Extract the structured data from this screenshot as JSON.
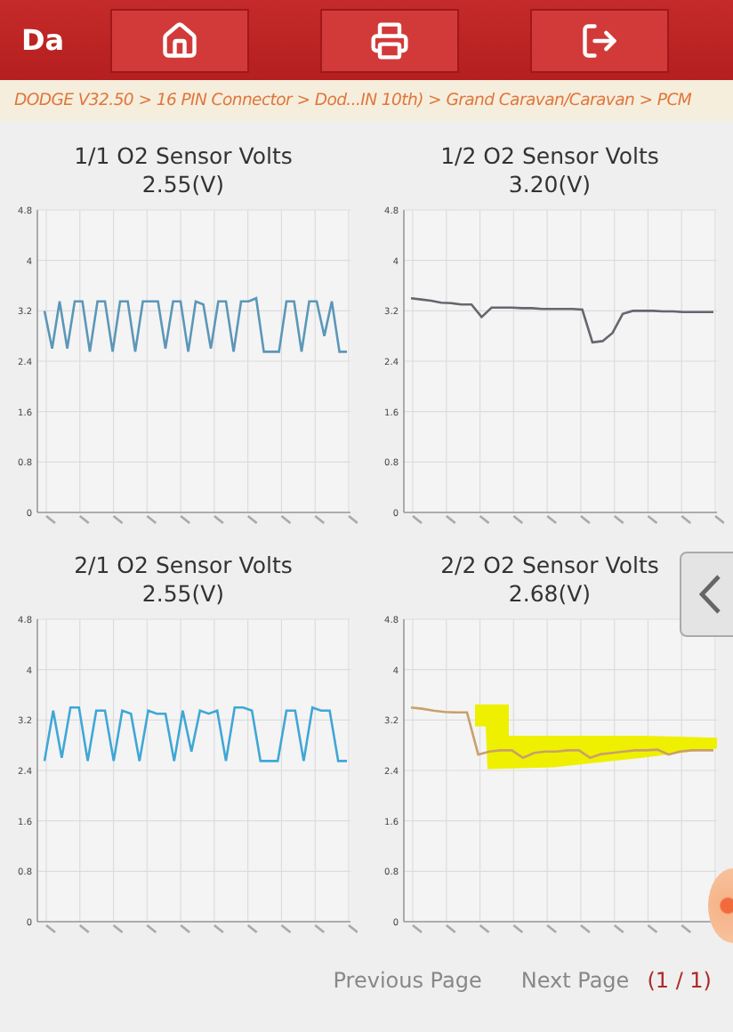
{
  "header": {
    "title": "Da",
    "buttons": [
      {
        "kind": "home"
      },
      {
        "kind": "print"
      },
      {
        "kind": "exit"
      }
    ]
  },
  "breadcrumb": "DODGE V32.50 > 16 PIN Connector > Dod...IN 10th) > Grand Caravan/Caravan > PCM",
  "charts": [
    {
      "title": "1/1 O2 Sensor Volts",
      "value": "2.55(V)",
      "chart_data": {
        "type": "line",
        "ylim": [
          0,
          4.8
        ],
        "yticks": [
          0,
          0.8,
          1.6,
          2.4,
          3.2,
          4,
          4.8
        ],
        "grid": true,
        "series": [
          {
            "color": "#5b97b8",
            "values": [
              3.2,
              2.6,
              3.35,
              2.6,
              3.35,
              3.35,
              2.55,
              3.35,
              3.35,
              2.55,
              3.35,
              3.35,
              2.55,
              3.35,
              3.35,
              3.35,
              2.6,
              3.35,
              3.35,
              2.55,
              3.35,
              3.3,
              2.6,
              3.35,
              3.35,
              2.55,
              3.35,
              3.35,
              3.4,
              2.55,
              2.55,
              2.55,
              3.35,
              3.35,
              2.55,
              3.35,
              3.35,
              2.8,
              3.35,
              2.55,
              2.55
            ]
          }
        ]
      }
    },
    {
      "title": "1/2 O2 Sensor Volts",
      "value": "3.20(V)",
      "chart_data": {
        "type": "line",
        "ylim": [
          0,
          4.8
        ],
        "yticks": [
          0,
          0.8,
          1.6,
          2.4,
          3.2,
          4,
          4.8
        ],
        "grid": true,
        "series": [
          {
            "color": "#66666e",
            "values": [
              3.4,
              3.38,
              3.36,
              3.33,
              3.32,
              3.3,
              3.3,
              3.1,
              3.25,
              3.25,
              3.25,
              3.24,
              3.24,
              3.23,
              3.23,
              3.23,
              3.23,
              3.22,
              2.7,
              2.72,
              2.85,
              3.15,
              3.2,
              3.2,
              3.2,
              3.19,
              3.19,
              3.18,
              3.18,
              3.18,
              3.18
            ]
          }
        ]
      }
    },
    {
      "title": "2/1 O2 Sensor Volts",
      "value": "2.55(V)",
      "chart_data": {
        "type": "line",
        "ylim": [
          0,
          4.8
        ],
        "yticks": [
          0,
          0.8,
          1.6,
          2.4,
          3.2,
          4,
          4.8
        ],
        "grid": true,
        "series": [
          {
            "color": "#3fa7d6",
            "values": [
              2.55,
              3.35,
              2.6,
              3.4,
              3.4,
              2.55,
              3.35,
              3.35,
              2.55,
              3.35,
              3.3,
              2.55,
              3.35,
              3.3,
              3.3,
              2.55,
              3.35,
              2.7,
              3.35,
              3.3,
              3.35,
              2.55,
              3.4,
              3.4,
              3.35,
              2.55,
              2.55,
              2.55,
              3.35,
              3.35,
              2.55,
              3.4,
              3.35,
              3.35,
              2.55,
              2.55
            ]
          }
        ]
      }
    },
    {
      "title": "2/2 O2 Sensor Volts",
      "value": "2.68(V)",
      "chart_data": {
        "type": "line",
        "ylim": [
          0,
          4.8
        ],
        "yticks": [
          0,
          0.8,
          1.6,
          2.4,
          3.2,
          4,
          4.8
        ],
        "grid": true,
        "series": [
          {
            "color": "#c9a06a",
            "values": [
              3.4,
              3.38,
              3.35,
              3.33,
              3.32,
              3.32,
              2.65,
              2.7,
              2.72,
              2.72,
              2.6,
              2.68,
              2.7,
              2.7,
              2.72,
              2.72,
              2.6,
              2.66,
              2.68,
              2.7,
              2.72,
              2.72,
              2.73,
              2.65,
              2.7,
              2.72,
              2.72,
              2.72
            ]
          }
        ]
      }
    }
  ],
  "footer": {
    "previous": "Previous Page",
    "next": "Next Page",
    "page": "(1 / 1)"
  }
}
